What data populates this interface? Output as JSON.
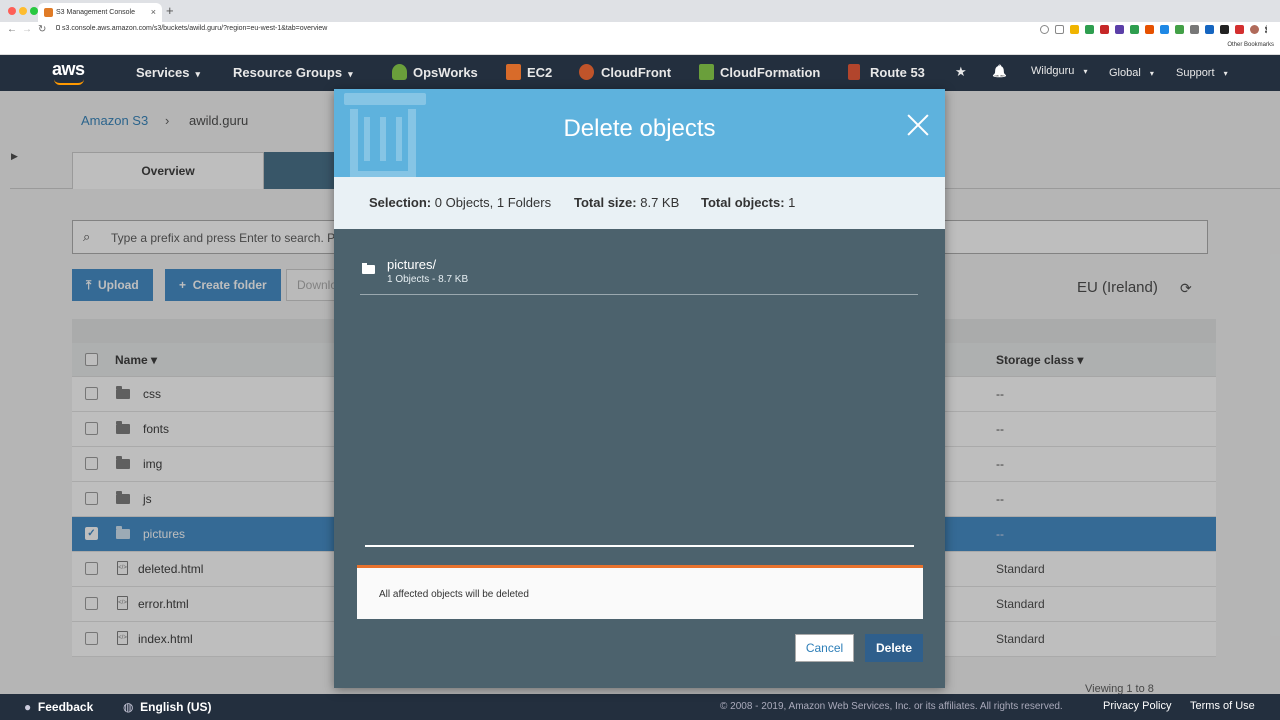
{
  "browser": {
    "tab_title": "S3 Management Console",
    "tab_close": "×",
    "new_tab": "+",
    "url": "s3.console.aws.amazon.com/s3/buckets/awild.guru/?region=eu-west-1&tab=overview",
    "back": "←",
    "forward": "→",
    "reload": "↻",
    "other_bookmarks": "Other Bookmarks"
  },
  "aws_nav": {
    "logo": "aws",
    "services": "Services",
    "resource_groups": "Resource Groups",
    "caret": "▾",
    "shortcuts": [
      "OpsWorks",
      "EC2",
      "CloudFront",
      "CloudFormation",
      "Route 53"
    ],
    "pin": "★",
    "bell": "🔔",
    "user": "Wildguru",
    "region": "Global",
    "support": "Support"
  },
  "page": {
    "breadcrumb_root": "Amazon S3",
    "breadcrumb_sep": "›",
    "breadcrumb_bucket": "awild.guru",
    "tab_overview": "Overview",
    "search_placeholder": "Type a prefix and press Enter to search. P",
    "upload": "Upload",
    "create_folder": "Create folder",
    "download": "Downlo",
    "region": "EU (Ireland)",
    "refresh": "⟳",
    "viewing": "Viewing 1 to 8",
    "col_name": "Name ▾",
    "col_storage": "Storage class ▾",
    "rows": [
      {
        "name": "css",
        "storage": "--"
      },
      {
        "name": "fonts",
        "storage": "--"
      },
      {
        "name": "img",
        "storage": "--"
      },
      {
        "name": "js",
        "storage": "--"
      },
      {
        "name": "pictures",
        "storage": "--"
      },
      {
        "name": "deleted.html",
        "storage": "Standard"
      },
      {
        "name": "error.html",
        "storage": "Standard"
      },
      {
        "name": "index.html",
        "storage": "Standard"
      }
    ]
  },
  "footer": {
    "feedback": "Feedback",
    "language": "English (US)",
    "copyright": "© 2008 - 2019, Amazon Web Services, Inc. or its affiliates. All rights reserved.",
    "privacy": "Privacy Policy",
    "terms": "Terms of Use"
  },
  "modal": {
    "title": "Delete objects",
    "selection_label": "Selection:",
    "selection_value": "0 Objects, 1 Folders",
    "size_label": "Total size:",
    "size_value": "8.7 KB",
    "objects_label": "Total objects:",
    "objects_value": "1",
    "item_name": "pictures/",
    "item_meta": "1 Objects - 8.7 KB",
    "warning": "All affected objects will be deleted",
    "cancel": "Cancel",
    "delete": "Delete"
  },
  "colors": {
    "aws_nav": "#232f3e",
    "modal_header": "#5eb2dd",
    "modal_body": "#4c626d",
    "warning_accent": "#e8722d",
    "primary_blue": "#3b87c5"
  }
}
